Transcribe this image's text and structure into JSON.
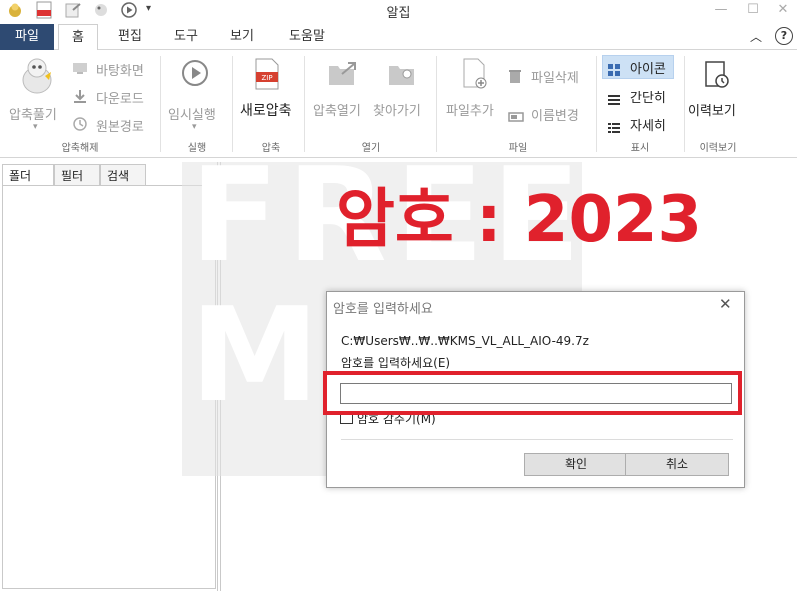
{
  "window": {
    "title": "알집"
  },
  "menu": {
    "file": "파일",
    "tabs": [
      "홈",
      "편집",
      "도구",
      "보기",
      "도움말"
    ],
    "active_tab": "홈",
    "help": "?"
  },
  "ribbon": {
    "extract": {
      "main": "압축풀기",
      "items": [
        "바탕화면",
        "다운로드",
        "원본경로"
      ],
      "group": "압축해제"
    },
    "run": {
      "main": "임시실행",
      "group": "실행"
    },
    "compress": {
      "main": "새로압축",
      "group": "압축",
      "zip_badge": "ZIP"
    },
    "open": {
      "items": [
        "압축열기",
        "찾아가기"
      ],
      "group": "열기"
    },
    "file": {
      "main": "파일추가",
      "items": [
        "파일삭제",
        "이름변경"
      ],
      "group": "파일"
    },
    "view": {
      "items": [
        "아이콘",
        "간단히",
        "자세히"
      ],
      "selected": "아이콘",
      "group": "표시"
    },
    "history": {
      "main": "이력보기",
      "group": "이력보기"
    }
  },
  "panel": {
    "tabs": [
      "폴더",
      "필터",
      "검색"
    ],
    "active_tab": "폴더",
    "close": "×"
  },
  "watermark": {
    "line1": "FREE",
    "line2": "MAN"
  },
  "headline": "암호 : 2023",
  "dialog": {
    "title": "암호를 입력하세요",
    "close": "✕",
    "path": "C:₩Users₩..₩..₩KMS_VL_ALL_AIO-49.7z",
    "prompt": "암호를 입력하세요(E)",
    "input_value": "",
    "checkbox_label": "암호 감추기(M)",
    "ok": "확인",
    "cancel": "취소"
  },
  "colors": {
    "file_tab": "#2e4a72",
    "accent_red": "#e0212c",
    "view_selected": "#cde1f5"
  }
}
